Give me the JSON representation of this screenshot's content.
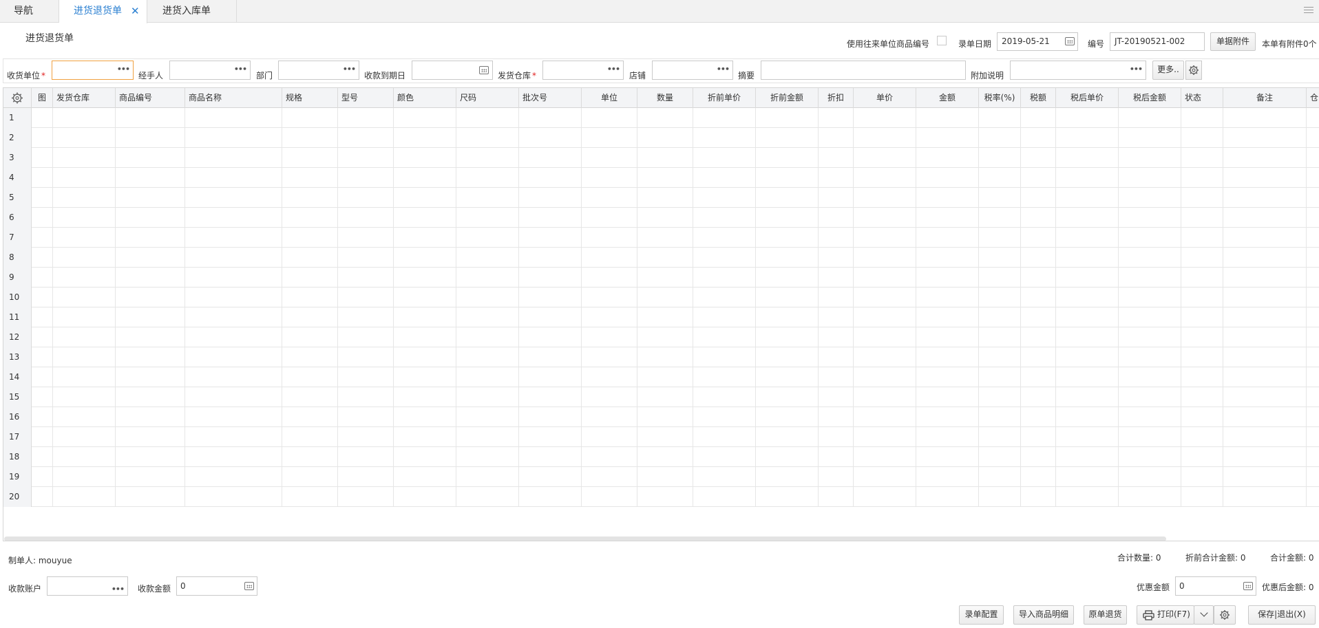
{
  "tabs": {
    "nav": "导航",
    "active": "进货退货单",
    "other": "进货入库单",
    "close": "✕"
  },
  "header": {
    "title": "进货退货单",
    "use_partner_code_label": "使用往来单位商品编号",
    "entry_date_label": "录单日期",
    "entry_date_value": "2019-05-21",
    "number_label": "编号",
    "number_value": "JT-20190521-002",
    "attachment_button": "单据附件",
    "attachment_info": "本单有附件0个"
  },
  "filters": {
    "receiver_label": "收货单位",
    "required_mark": "*",
    "handler_label": "经手人",
    "department_label": "部门",
    "due_date_label": "收款到期日",
    "warehouse_label": "发货仓库",
    "store_label": "店铺",
    "summary_label": "摘要",
    "extra_label": "附加说明",
    "more_button": "更多.."
  },
  "grid": {
    "columns": [
      "图",
      "发货仓库",
      "商品编号",
      "商品名称",
      "规格",
      "型号",
      "颜色",
      "尺码",
      "批次号",
      "单位",
      "数量",
      "折前单价",
      "折前金额",
      "折扣",
      "单价",
      "金额",
      "税率(%)",
      "税额",
      "税后单价",
      "税后金额",
      "状态",
      "备注",
      "仓"
    ],
    "rows": [
      "1",
      "2",
      "3",
      "4",
      "5",
      "6",
      "7",
      "8",
      "9",
      "10",
      "11",
      "12",
      "13",
      "14",
      "15",
      "16",
      "17",
      "18",
      "19",
      "20"
    ]
  },
  "footer": {
    "creator": "制单人:  mouyue",
    "total_qty": "合计数量:  0",
    "pre_discount_total": "折前合计金额:  0",
    "total_amount": "合计金额:  0",
    "account_label": "收款账户",
    "amount_label": "收款金额",
    "amount_value": "0",
    "discount_label": "优惠金额",
    "discount_value": "0",
    "after_discount": "优惠后金额:  0"
  },
  "actions": {
    "config": "录单配置",
    "import": "导入商品明细",
    "original_return": "原单退货",
    "print": "打印(F7)",
    "save_exit": "保存|退出(X)"
  },
  "colors": {
    "accent": "#2a7fd1",
    "required": "#e02020",
    "focus_border": "#f0a040"
  }
}
